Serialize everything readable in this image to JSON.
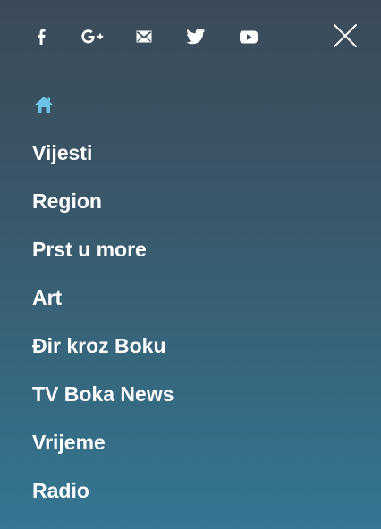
{
  "social": [
    {
      "name": "facebook",
      "icon": "facebook-icon"
    },
    {
      "name": "google-plus",
      "icon": "google-plus-icon"
    },
    {
      "name": "email",
      "icon": "mail-icon"
    },
    {
      "name": "twitter",
      "icon": "twitter-icon"
    },
    {
      "name": "youtube",
      "icon": "youtube-icon"
    }
  ],
  "close_icon": "close-icon",
  "home_icon": "home-icon",
  "colors": {
    "home_icon": "#6cc3e8",
    "text": "#ffffff",
    "bg_top": "#3b4a58",
    "bg_bottom": "#357692"
  },
  "nav": {
    "items": [
      {
        "label": "Vijesti"
      },
      {
        "label": "Region"
      },
      {
        "label": "Prst u more"
      },
      {
        "label": "Art"
      },
      {
        "label": "Đir kroz Boku"
      },
      {
        "label": "TV Boka News"
      },
      {
        "label": "Vrijeme"
      },
      {
        "label": "Radio"
      }
    ]
  }
}
